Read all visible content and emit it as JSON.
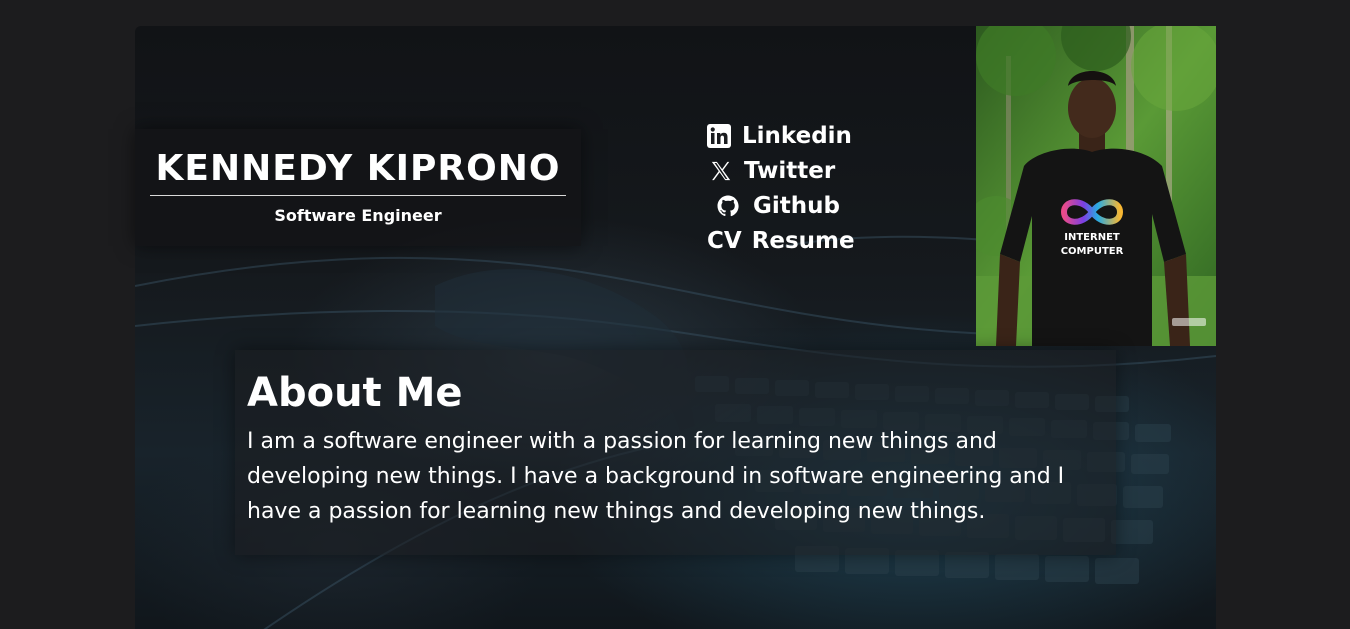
{
  "header": {
    "name": "KENNEDY KIPRONO",
    "role": "Software Engineer"
  },
  "links": [
    {
      "label": "Linkedin",
      "icon": "linkedin-icon"
    },
    {
      "label": "Twitter",
      "icon": "x-twitter-icon"
    },
    {
      "label": "Github",
      "icon": "github-icon"
    },
    {
      "label": "Resume",
      "icon": "cv-icon",
      "icon_text": "CV"
    }
  ],
  "photo": {
    "shirt_line1": "INTERNET",
    "shirt_line2": "COMPUTER"
  },
  "about": {
    "title": "About Me",
    "body": "I am a software engineer with a passion for learning new things and developing new things. I have a background in software engineering and I have a passion for learning new things and developing new things."
  },
  "colors": {
    "page_background": "#1c1c1e",
    "text": "#ffffff",
    "card_background": "#141416"
  }
}
